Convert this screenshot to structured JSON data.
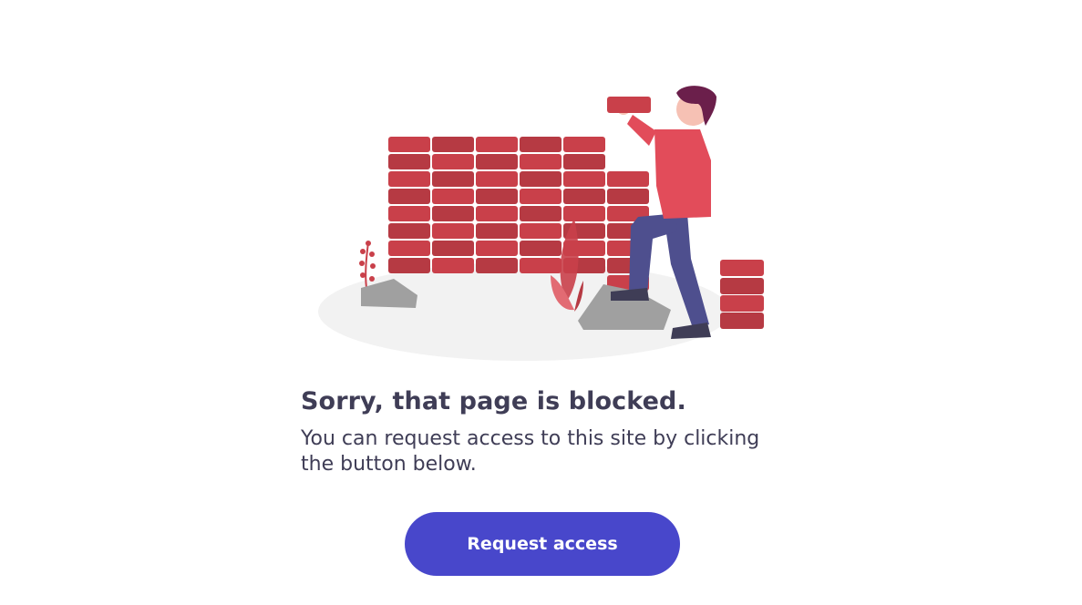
{
  "illustration": {
    "icon": "blocked-wall-illustration",
    "colors": {
      "brick": "#c9404a",
      "brick_dark": "#b63a43",
      "shirt": "#e24c5a",
      "pants": "#4e4f8e",
      "hair": "#6b1f4b",
      "skin": "#f6c1b4",
      "ground": "#f2f2f2",
      "rock": "#a0a0a0"
    }
  },
  "message": {
    "title": "Sorry, that page is blocked.",
    "description": "You can request access to this site by clicking the button below."
  },
  "actions": {
    "request_access_label": "Request access"
  },
  "theme": {
    "accent": "#4847cb",
    "text": "#3f3d56",
    "background": "#ffffff"
  }
}
